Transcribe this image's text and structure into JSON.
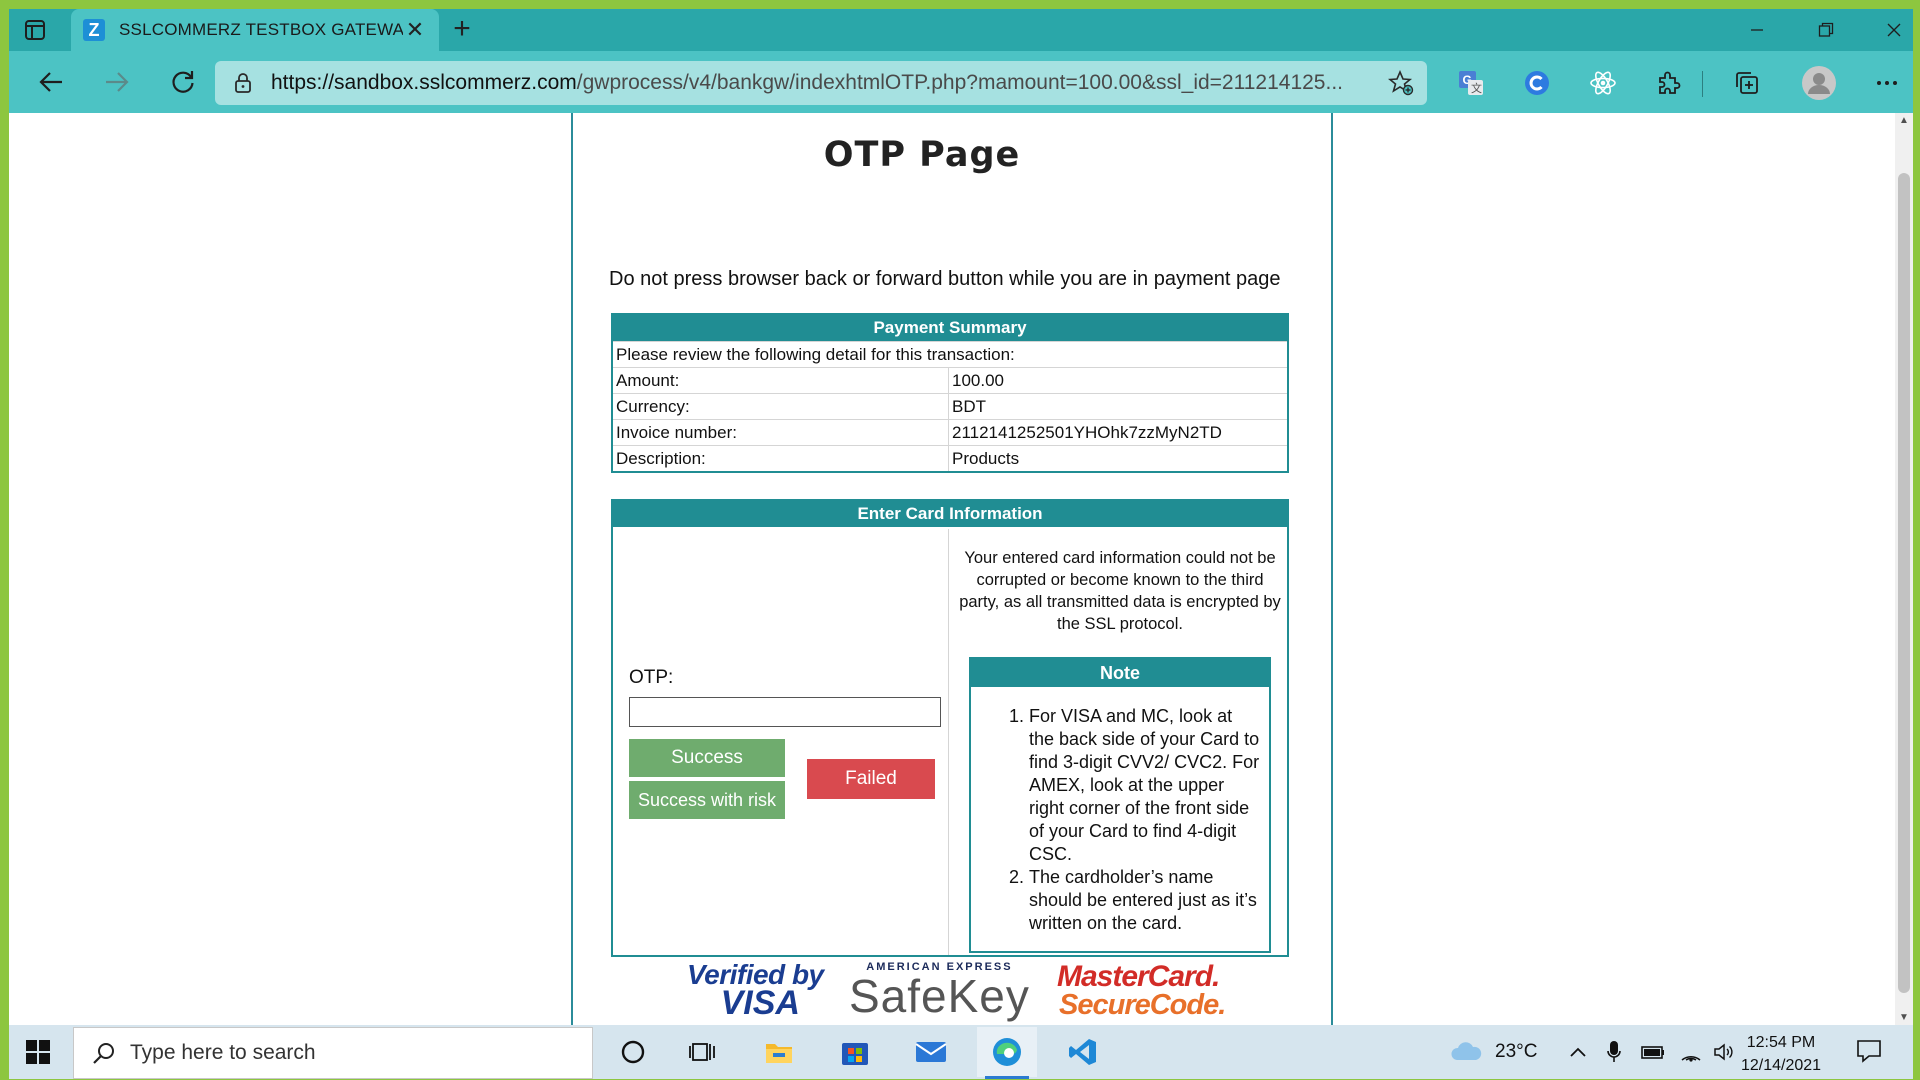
{
  "browser": {
    "tab_title": "SSLCOMMERZ TESTBOX GATEWAY",
    "tab_favicon_letter": "Z",
    "url_host": "https://sandbox.sslcommerz.com",
    "url_path": "/gwprocess/v4/bankgw/indexhtmlOTP.php?mamount=100.00&ssl_id=211214125...",
    "icons": [
      "tab-actions-icon",
      "close-icon",
      "plus-icon",
      "minimize-icon",
      "restore-icon",
      "back-icon",
      "forward-icon",
      "refresh-icon",
      "lock-icon",
      "favorite-add-icon",
      "translate-icon",
      "grammar-icon",
      "react-icon",
      "extensions-icon",
      "collections-icon",
      "profile-icon",
      "more-icon"
    ]
  },
  "page": {
    "title": "OTP Page",
    "warning": "Do not press browser back or forward button while you are in payment page",
    "summary": {
      "heading": "Payment Summary",
      "intro": "Please review the following detail for this transaction:",
      "rows": [
        {
          "label": "Amount:",
          "value": "100.00"
        },
        {
          "label": "Currency:",
          "value": "BDT"
        },
        {
          "label": "Invoice number:",
          "value": "2112141252501YHOhk7zzMyN2TD"
        },
        {
          "label": "Description:",
          "value": "Products"
        }
      ]
    },
    "card": {
      "heading": "Enter Card Information",
      "otp_label": "OTP:",
      "otp_value": "",
      "success_label": "Success",
      "risk_label": "Success with risk",
      "failed_label": "Failed",
      "secure_text": "Your entered card information could not be corrupted or become known to the third party, as all transmitted data is encrypted by the SSL protocol.",
      "note_heading": "Note",
      "notes": [
        "For VISA and MC, look at the back side of your Card to find 3-digit CVV2/ CVC2. For AMEX, look at the upper right corner of the front side of your Card to find 4-digit CSC.",
        "The cardholder’s name should be entered just as it’s written on the card."
      ]
    },
    "logos": {
      "visa_line1": "Verified by",
      "visa_line2": "VISA",
      "amex_line1": "AMERICAN EXPRESS",
      "amex_line2": "SafeKey",
      "mc_line1": "MasterCard.",
      "mc_line2": "SecureCode."
    }
  },
  "taskbar": {
    "search_placeholder": "Type here to search",
    "temperature": "23°C",
    "time": "12:54 PM",
    "date": "12/14/2021",
    "icons": [
      "windows-start-icon",
      "search-icon",
      "cortana-icon",
      "task-view-icon",
      "file-explorer-icon",
      "microsoft-store-icon",
      "mail-icon",
      "edge-icon",
      "vscode-icon",
      "weather-icon",
      "chevron-up-icon",
      "microphone-icon",
      "battery-icon",
      "wifi-icon",
      "volume-icon",
      "notification-icon"
    ]
  },
  "colors": {
    "accent": "#208d93",
    "success": "#6fac6e",
    "failed": "#d94a4f",
    "tabstrip": "#2aa7a9",
    "toolbar": "#4cc3c4"
  }
}
